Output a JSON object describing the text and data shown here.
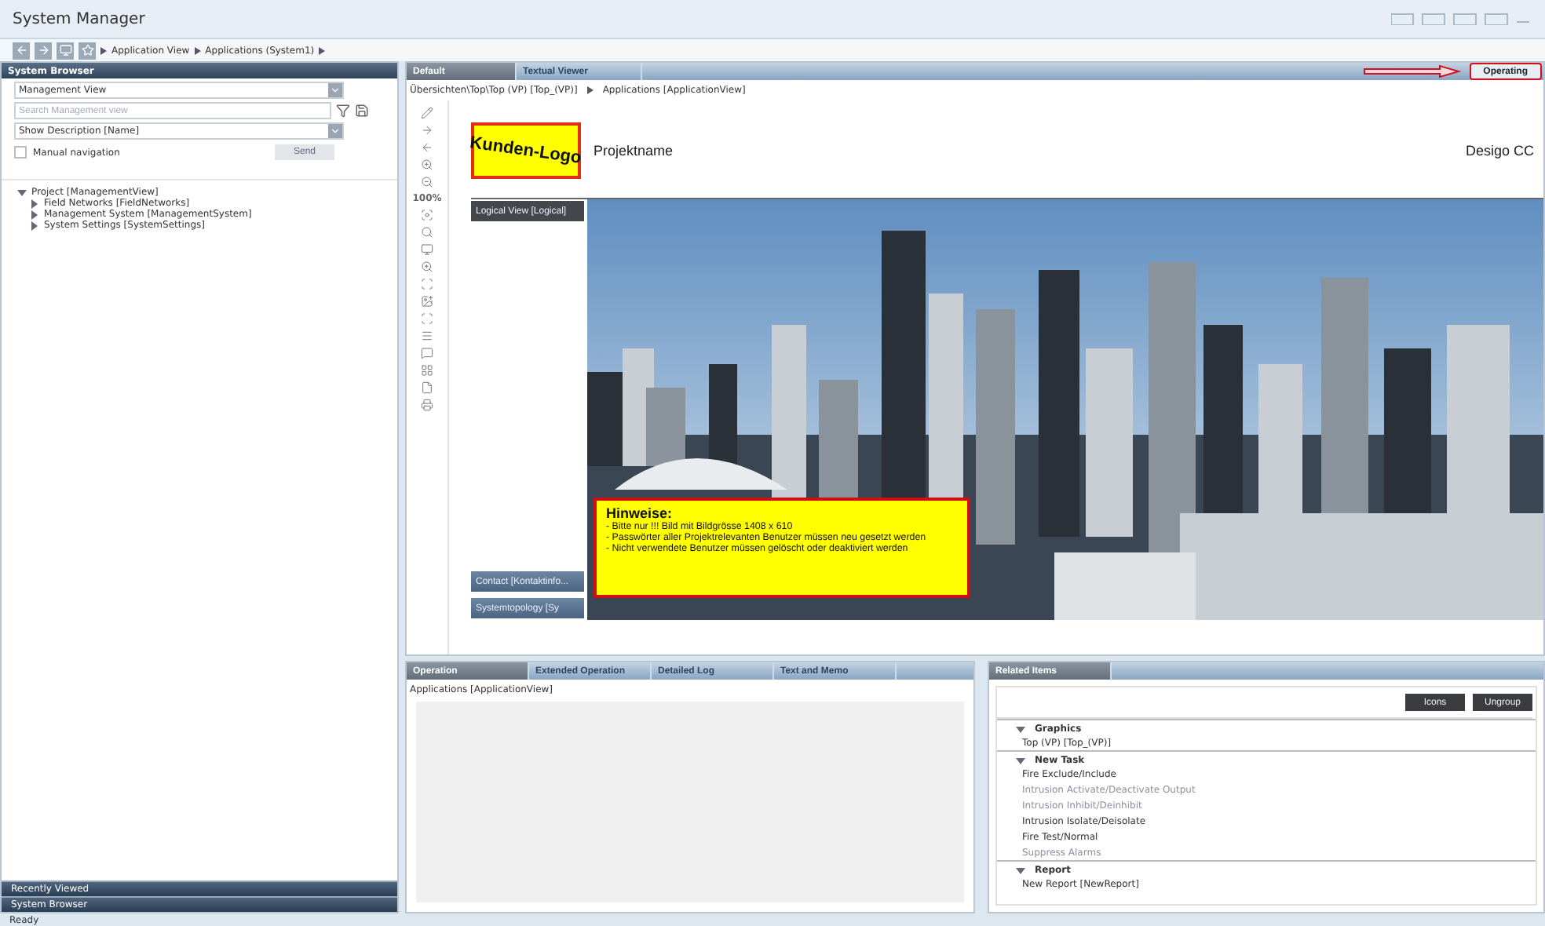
{
  "window": {
    "title": "System Manager"
  },
  "nav": {
    "crumbs": [
      "Application View",
      "Applications (System1)"
    ]
  },
  "system_browser": {
    "title": "System Browser",
    "view_select": "Management View",
    "search": {
      "placeholder": "Search Management view"
    },
    "description_select": "Show Description [Name]",
    "manual_navigation": {
      "label": "Manual navigation",
      "checked": false
    },
    "send_button": "Send",
    "tree": [
      {
        "label": "Project [ManagementView]",
        "expanded": true,
        "children": [
          {
            "label": "Field Networks [FieldNetworks]",
            "expanded": false
          },
          {
            "label": "Management System [ManagementSystem]",
            "expanded": false
          },
          {
            "label": "System Settings [SystemSettings]",
            "expanded": false
          }
        ]
      }
    ],
    "footer_bars": [
      "Recently Viewed",
      "System Browser"
    ]
  },
  "main_tabs": [
    {
      "label": "Default",
      "selected": true
    },
    {
      "label": "Textual Viewer",
      "selected": false
    }
  ],
  "mode_button": "Operating",
  "breadcrumb": [
    "Übersichten\\Top\\Top (VP) [Top_(VP)]",
    "Applications [ApplicationView]"
  ],
  "zoom_label": "100%",
  "graphic": {
    "logo": "Kunden-Logo",
    "project_name": "Projektname",
    "product": "Desigo CC",
    "side_buttons": [
      {
        "label": "Logical View [Logical]",
        "selected": true
      },
      {
        "label": "Contact [Kontaktinfo...",
        "selected": false
      },
      {
        "label": "Systemtopology [Sy",
        "selected": false
      }
    ],
    "notice": {
      "title": "Hinweise:",
      "lines": [
        "- Bitte nur !!! Bild mit Bildgrösse 1408 x 610",
        "- Passwörter aller Projektrelevanten Benutzer müssen neu gesetzt werden",
        "- Nicht verwendete Benutzer müssen gelöscht oder deaktiviert werden"
      ]
    }
  },
  "operation_tabs": [
    {
      "label": "Operation",
      "selected": true
    },
    {
      "label": "Extended Operation",
      "selected": false
    },
    {
      "label": "Detailed Log",
      "selected": false
    },
    {
      "label": "Text and Memo",
      "selected": false
    }
  ],
  "operation_header": "Applications [ApplicationView]",
  "related": {
    "tab": {
      "label": "Related Items",
      "selected": true
    },
    "buttons": [
      "Icons",
      "Ungroup"
    ],
    "groups": [
      {
        "title": "Graphics",
        "expanded": true,
        "items": [
          {
            "label": "Top (VP) [Top_(VP)]",
            "disabled": false
          }
        ]
      },
      {
        "title": "New Task",
        "expanded": true,
        "items": [
          {
            "label": "Fire Exclude/Include",
            "disabled": false
          },
          {
            "label": "Intrusion Activate/Deactivate Output",
            "disabled": true
          },
          {
            "label": "Intrusion Inhibit/Deinhibit",
            "disabled": true
          },
          {
            "label": "Intrusion Isolate/Deisolate",
            "disabled": false
          },
          {
            "label": "Fire Test/Normal",
            "disabled": false
          },
          {
            "label": "Suppress Alarms",
            "disabled": true
          }
        ]
      },
      {
        "title": "Report",
        "expanded": true,
        "items": [
          {
            "label": "New Report [NewReport]",
            "disabled": false
          }
        ]
      }
    ]
  },
  "status_bar": "Ready"
}
